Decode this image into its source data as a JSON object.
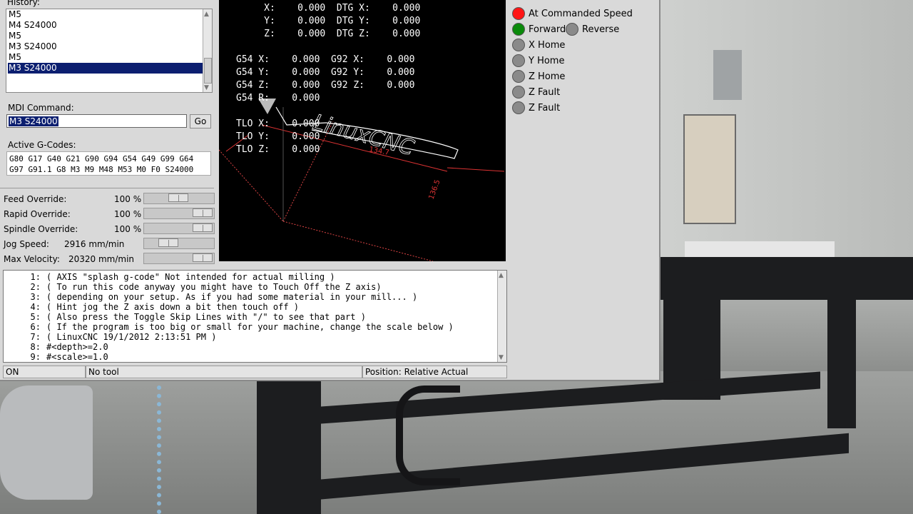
{
  "colors": {
    "selection": "#0c1f70",
    "led_red": "#ff1414",
    "led_green": "#0a8a0a",
    "led_off": "#8a8a8a"
  },
  "history": {
    "label": "History:",
    "items": [
      "M5",
      "M4 S24000",
      "M5",
      "M3 S24000",
      "M5",
      "M3 S24000"
    ],
    "selected_index": 5
  },
  "mdi": {
    "label": "MDI Command:",
    "value": "M3 S24000",
    "go_label": "Go"
  },
  "gcodes": {
    "label": "Active G-Codes:",
    "line1": "G80 G17 G40 G21 G90 G94 G54 G49 G99 G64",
    "line2": "G97 G91.1 G8 M3 M9 M48 M53 M0 F0 S24000"
  },
  "overrides": [
    {
      "name": "Feed Override:",
      "value": "100 %",
      "level": 0.5
    },
    {
      "name": "Rapid Override:",
      "value": "100 %",
      "level": 1.0
    },
    {
      "name": "Spindle Override:",
      "value": "100 %",
      "level": 1.0
    },
    {
      "name": "Jog Speed:",
      "value": "2916 mm/min",
      "level": 0.3
    },
    {
      "name": "Max Velocity:",
      "value": "20320 mm/min",
      "level": 1.0
    }
  ],
  "dro": {
    "x": "     X:    0.000  DTG X:    0.000",
    "y": "     Y:    0.000  DTG Y:    0.000",
    "z": "     Z:    0.000  DTG Z:    0.000",
    "g54x": "G54 X:    0.000  G92 X:    0.000",
    "g54y": "G54 Y:    0.000  G92 Y:    0.000",
    "g54z": "G54 Z:    0.000  G92 Z:    0.000",
    "g54r": "G54 R:    0.000",
    "tlox": "TLO X:    0.000",
    "tloy": "TLO Y:    0.000",
    "tloz": "TLO Z:    0.000",
    "dim1": "134.7",
    "dim2": "136.5",
    "logo": "LinuxCNC"
  },
  "code_lines": [
    {
      "num": "1:",
      "text": "( AXIS \"splash g-code\" Not intended for actual milling )"
    },
    {
      "num": "2:",
      "text": "( To run this code anyway you might have to Touch Off the Z axis)"
    },
    {
      "num": "3:",
      "text": "( depending on your setup. As if you had some material in your mill... )"
    },
    {
      "num": "4:",
      "text": "( Hint jog the Z axis down a bit then touch off )"
    },
    {
      "num": "5:",
      "text": "( Also press the Toggle Skip Lines with \"/\" to see that part )"
    },
    {
      "num": "6:",
      "text": "( If the program is too big or small for your machine, change the scale below )"
    },
    {
      "num": "7:",
      "text": "( LinuxCNC 19/1/2012 2:13:51 PM )"
    },
    {
      "num": "8:",
      "text": "#<depth>=2.0"
    },
    {
      "num": "9:",
      "text": "#<scale>=1.0"
    }
  ],
  "status": {
    "machine": "ON",
    "tool": "No tool",
    "position": "Position: Relative Actual"
  },
  "indicators": [
    {
      "label": "At Commanded Speed",
      "state": "red"
    },
    {
      "label": "Forward",
      "state": "green"
    },
    {
      "label": "Reverse",
      "state": "off"
    },
    {
      "label": "X Home",
      "state": "off"
    },
    {
      "label": "Y Home",
      "state": "off"
    },
    {
      "label": "Z Home",
      "state": "off"
    },
    {
      "label": "Z Fault",
      "state": "off"
    },
    {
      "label": "Z Fault",
      "state": "off"
    }
  ]
}
